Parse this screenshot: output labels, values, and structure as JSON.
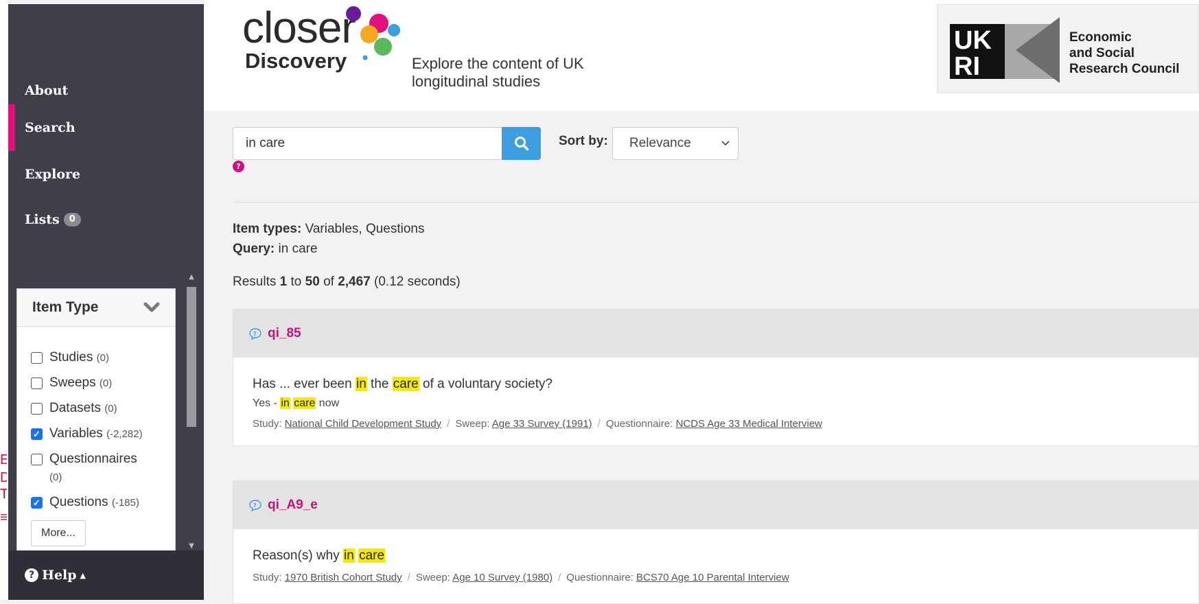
{
  "edge_fragments": [
    "E",
    "D",
    "TU",
    "≡"
  ],
  "nav": {
    "about": "About",
    "search": "Search",
    "explore": "Explore",
    "lists": "Lists",
    "lists_count": "0",
    "help": "Help"
  },
  "facet": {
    "title": "Item Type",
    "items": [
      {
        "label": "Studies",
        "count": "(0)",
        "checked": false
      },
      {
        "label": "Sweeps",
        "count": "(0)",
        "checked": false
      },
      {
        "label": "Datasets",
        "count": "(0)",
        "checked": false
      },
      {
        "label": "Variables",
        "count": "(-2,282)",
        "checked": true
      },
      {
        "label": "Questionnaires",
        "count": "(0)",
        "checked": false
      },
      {
        "label": "Questions",
        "count": "(-185)",
        "checked": true
      }
    ],
    "more_label": "More..."
  },
  "header": {
    "logo_top": "closer",
    "logo_bottom": "Discovery",
    "tagline_1": "Explore the content of UK",
    "tagline_2": "longitudinal studies",
    "ukri_text_1": "Economic",
    "ukri_text_2": "and Social",
    "ukri_text_3": "Research Council"
  },
  "search": {
    "value": "in care",
    "sort_label": "Sort by:",
    "sort_value": "Relevance"
  },
  "summary": {
    "item_types_label": "Item types:",
    "item_types_value": "Variables, Questions",
    "query_label": "Query:",
    "query_value": "in care",
    "results_prefix": "Results",
    "from": "1",
    "to_word": "to",
    "to": "50",
    "of_word": "of",
    "total": "2,467",
    "time": "(0.12 seconds)"
  },
  "results": [
    {
      "title": "qi_85",
      "question_parts": [
        "Has ... ever been ",
        "in",
        " the ",
        "care",
        " of a voluntary society?"
      ],
      "answer_parts": [
        "Yes - ",
        "in",
        " ",
        "care",
        " now"
      ],
      "study_label": "Study:",
      "study": "National Child Development Study",
      "sweep_label": "Sweep:",
      "sweep": "Age 33 Survey (1991)",
      "questionnaire_label": "Questionnaire:",
      "questionnaire": "NCDS Age 33 Medical Interview"
    },
    {
      "title": "qi_A9_e",
      "question_parts": [
        "Reason(s) why ",
        "in",
        " ",
        "care"
      ],
      "study_label": "Study:",
      "study": "1970 British Cohort Study",
      "sweep_label": "Sweep:",
      "sweep": "Age 10 Survey (1980)",
      "questionnaire_label": "Questionnaire:",
      "questionnaire": "BCS70 Age 10 Parental Interview"
    }
  ],
  "colors": {
    "sidebar": "#3f3f4a",
    "accent": "#e0107c",
    "link_title": "#c8107a",
    "search_button": "#3d9ee0",
    "highlight": "#f5ea00"
  },
  "icons": [
    "search-icon",
    "question-circle-icon",
    "chevron-down-icon",
    "question-bubble-icon"
  ]
}
